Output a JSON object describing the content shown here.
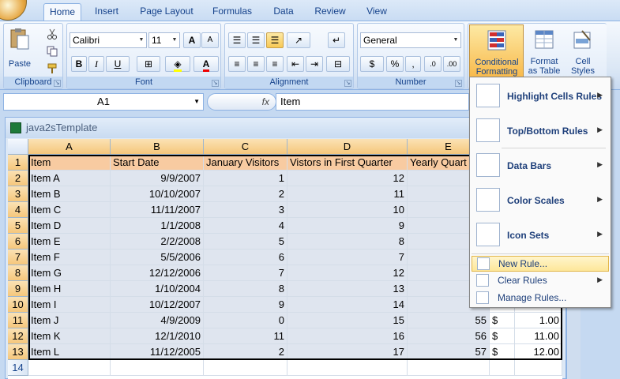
{
  "ribbon_tabs": [
    "Home",
    "Insert",
    "Page Layout",
    "Formulas",
    "Data",
    "Review",
    "View"
  ],
  "clipboard": {
    "paste_label": "Paste",
    "group_label": "Clipboard"
  },
  "font": {
    "name": "Calibri",
    "size": "11",
    "grow": "A",
    "shrink": "A",
    "bold": "B",
    "italic": "I",
    "underline": "U",
    "font_color": "A",
    "group_label": "Font"
  },
  "alignment": {
    "group_label": "Alignment"
  },
  "number": {
    "format": "General",
    "currency": "$",
    "percent": "%",
    "comma": ",",
    "group_label": "Number"
  },
  "styles": {
    "conditional_formatting": "Conditional Formatting",
    "format_as_table": "Format as Table",
    "cell_styles": "Cell Styles"
  },
  "formula_bar": {
    "name_box": "A1",
    "fx": "fx",
    "content": "Item"
  },
  "workbook": {
    "title": "java2sTemplate"
  },
  "columns": [
    "A",
    "B",
    "C",
    "D",
    "E"
  ],
  "rows": [
    "1",
    "2",
    "3",
    "4",
    "5",
    "6",
    "7",
    "8",
    "9",
    "10",
    "11",
    "12",
    "13",
    "14"
  ],
  "headers": [
    "Item",
    "Start Date",
    "January Visitors",
    "Vistors in First Quarter",
    "Yearly Quart"
  ],
  "data": [
    [
      "Item A",
      "9/9/2007",
      "1",
      "12",
      "",
      "",
      ""
    ],
    [
      "Item B",
      "10/10/2007",
      "2",
      "11",
      "",
      "",
      ""
    ],
    [
      "Item C",
      "11/11/2007",
      "3",
      "10",
      "",
      "",
      ""
    ],
    [
      "Item D",
      "1/1/2008",
      "4",
      "9",
      "",
      "",
      ""
    ],
    [
      "Item E",
      "2/2/2008",
      "5",
      "8",
      "",
      "",
      ""
    ],
    [
      "Item F",
      "5/5/2006",
      "6",
      "7",
      "",
      "",
      ""
    ],
    [
      "Item G",
      "12/12/2006",
      "7",
      "12",
      "",
      "",
      ""
    ],
    [
      "Item H",
      "1/10/2004",
      "8",
      "13",
      "",
      "",
      ""
    ],
    [
      "Item I",
      "10/12/2007",
      "9",
      "14",
      "",
      "",
      ""
    ],
    [
      "Item J",
      "4/9/2009",
      "0",
      "15",
      "55",
      "$",
      "1.00"
    ],
    [
      "Item K",
      "12/1/2010",
      "11",
      "16",
      "56",
      "$",
      "11.00"
    ],
    [
      "Item L",
      "11/12/2005",
      "2",
      "17",
      "57",
      "$",
      "12.00"
    ]
  ],
  "menu": {
    "items": [
      "Highlight Cells Rules",
      "Top/Bottom Rules",
      "Data Bars",
      "Color Scales",
      "Icon Sets"
    ],
    "small_items": [
      "New Rule...",
      "Clear Rules",
      "Manage Rules..."
    ]
  }
}
